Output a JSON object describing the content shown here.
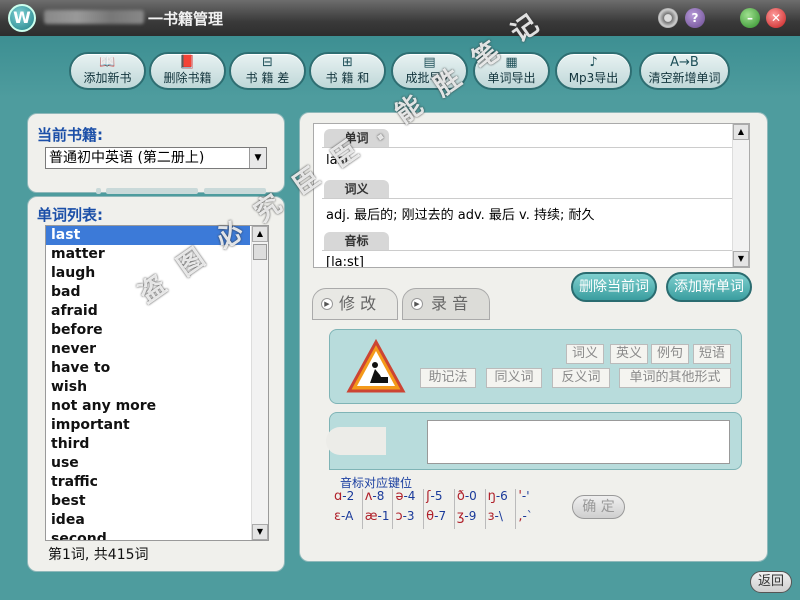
{
  "window": {
    "title": "一书籍管理",
    "logo_letter": "W"
  },
  "titlebar_buttons": [
    "disc-icon",
    "help-icon",
    "minimize-icon",
    "close-icon"
  ],
  "toolbar": {
    "items": [
      {
        "label": "添加新书",
        "icon": "book-add-icon"
      },
      {
        "label": "删除书籍",
        "icon": "book-delete-icon"
      },
      {
        "label": "书 籍 差",
        "icon": "book-diff-icon"
      },
      {
        "label": "书 籍 和",
        "icon": "book-sum-icon"
      },
      {
        "label": "成批导入",
        "icon": "batch-import-icon"
      },
      {
        "label": "单词导出",
        "icon": "word-export-icon"
      },
      {
        "label": "Mp3导出",
        "icon": "mp3-export-icon"
      },
      {
        "label": "清空新增单词",
        "icon": "clear-words-icon"
      }
    ]
  },
  "left": {
    "current_book_label": "当前书籍:",
    "current_book": "普通初中英语 (第二册上)",
    "word_list_label": "单词列表:",
    "words": [
      "last",
      "matter",
      "laugh",
      "bad",
      "afraid",
      "before",
      "never",
      "have to",
      "wish",
      "not any more",
      "important",
      "third",
      "use",
      "traffic",
      "best",
      "idea",
      "second"
    ],
    "selected_index": 0,
    "count_text": "第1词, 共415词"
  },
  "detail": {
    "word_tag": "单词",
    "word_value": "last",
    "meaning_tag": "词义",
    "meaning_value": "adj. 最后的; 刚过去的 adv. 最后 v. 持续; 耐久",
    "phonetic_tag": "音标",
    "phonetic_value": "[la:st]"
  },
  "actions": {
    "delete_word": "删除当前词",
    "add_word": "添加新单词"
  },
  "tabs": [
    {
      "label": "修 改",
      "active": true
    },
    {
      "label": "录 音",
      "active": false
    }
  ],
  "edit_chips_row1": [
    "词义",
    "英义",
    "例句",
    "短语"
  ],
  "edit_chips_row2": [
    "助记法",
    "同义词",
    "反义词",
    "单词的其他形式"
  ],
  "phonetic_keys_label": "音标对应键位",
  "phonetic_keys": [
    [
      [
        "ɑ",
        "-2"
      ],
      [
        "ʌ",
        "-8"
      ],
      [
        "ə",
        "-4"
      ],
      [
        "ʃ",
        "-5"
      ],
      [
        "ð",
        "-0"
      ],
      [
        "ŋ",
        "-6"
      ],
      [
        "'",
        "-'"
      ]
    ],
    [
      [
        "ɛ",
        "-A"
      ],
      [
        "æ",
        "-1"
      ],
      [
        "ɔ",
        "-3"
      ],
      [
        "θ",
        "-7"
      ],
      [
        "ʒ",
        "-9"
      ],
      [
        "ɜ",
        "-\\"
      ],
      [
        ",",
        "-`"
      ]
    ]
  ],
  "confirm_label": "确 定",
  "back_label": "返回",
  "watermark_text": "盗 图 必 究    臣 臣 . 能 胜 笔 记"
}
